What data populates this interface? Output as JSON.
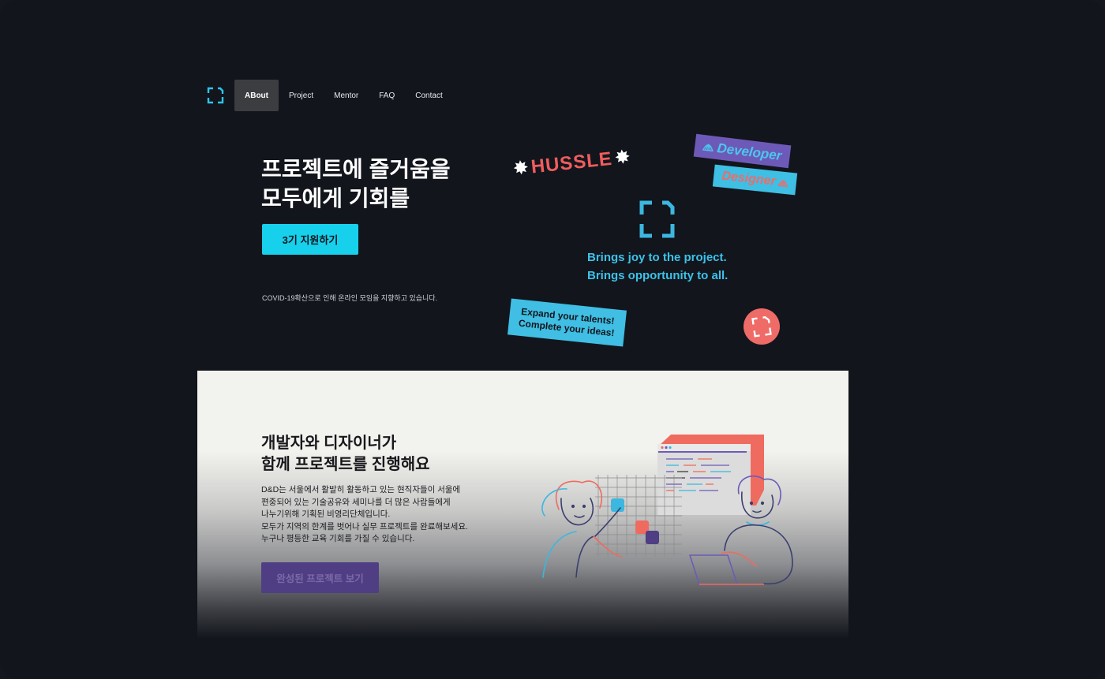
{
  "nav": {
    "logo": "dd-bracket-logo",
    "items": [
      {
        "label": "ABout",
        "active": true
      },
      {
        "label": "Project",
        "active": false
      },
      {
        "label": "Mentor",
        "active": false
      },
      {
        "label": "FAQ",
        "active": false
      },
      {
        "label": "Contact",
        "active": false
      }
    ]
  },
  "hero": {
    "title_line1": "프로젝트에 즐거움을",
    "title_line2": "모두에게 기회를",
    "apply_label": "3기 지원하기",
    "note": "COVID-19확산으로 인해 온라인 모임을 지향하고 있습니다."
  },
  "stickers": {
    "hussle": "HUSSLE",
    "developer": "Developer",
    "designer": "Designer",
    "tagline_line1": "Brings joy to the project.",
    "tagline_line2": "Brings opportunity to all.",
    "expand_line1": "Expand your talents!",
    "expand_line2": "Complete your ideas!"
  },
  "about": {
    "title_line1": "개발자와 디자이너가",
    "title_line2": "함께 프로젝트를 진행해요",
    "desc": [
      "D&D는 서울에서 활발히 활동하고 있는 현직자들이 서울에",
      "편중되어 있는 기술공유와 세미나를 더 많은 사람들에게",
      "나누기위해 기획된 비영리단체입니다.",
      "모두가 지역의 한계를 벗어나 실무 프로젝트를 완료해보세요.",
      "누구나 평등한 교육 기회를 가질 수 있습니다."
    ],
    "projects_label": "완성된 프로젝트 보기"
  },
  "colors": {
    "accent_cyan": "#17d0ec",
    "accent_red": "#ef5d5d",
    "accent_purple": "#6d5ab8",
    "background": "#12151c"
  }
}
